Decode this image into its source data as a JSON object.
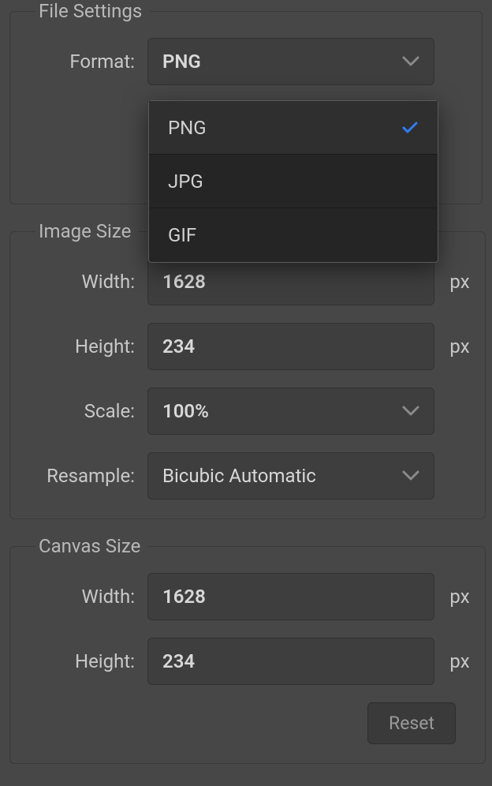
{
  "file_settings": {
    "legend": "File Settings",
    "format_label": "Format:",
    "format_value": "PNG",
    "dropdown": {
      "options": [
        "PNG",
        "JPG",
        "GIF"
      ],
      "selected_index": 0
    }
  },
  "image_size": {
    "legend": "Image Size",
    "width_label": "Width:",
    "width_value": "1628",
    "height_label": "Height:",
    "height_value": "234",
    "scale_label": "Scale:",
    "scale_value": "100%",
    "resample_label": "Resample:",
    "resample_value": "Bicubic Automatic",
    "unit": "px"
  },
  "canvas_size": {
    "legend": "Canvas Size",
    "width_label": "Width:",
    "width_value": "1628",
    "height_label": "Height:",
    "height_value": "234",
    "unit": "px",
    "reset_label": "Reset"
  }
}
